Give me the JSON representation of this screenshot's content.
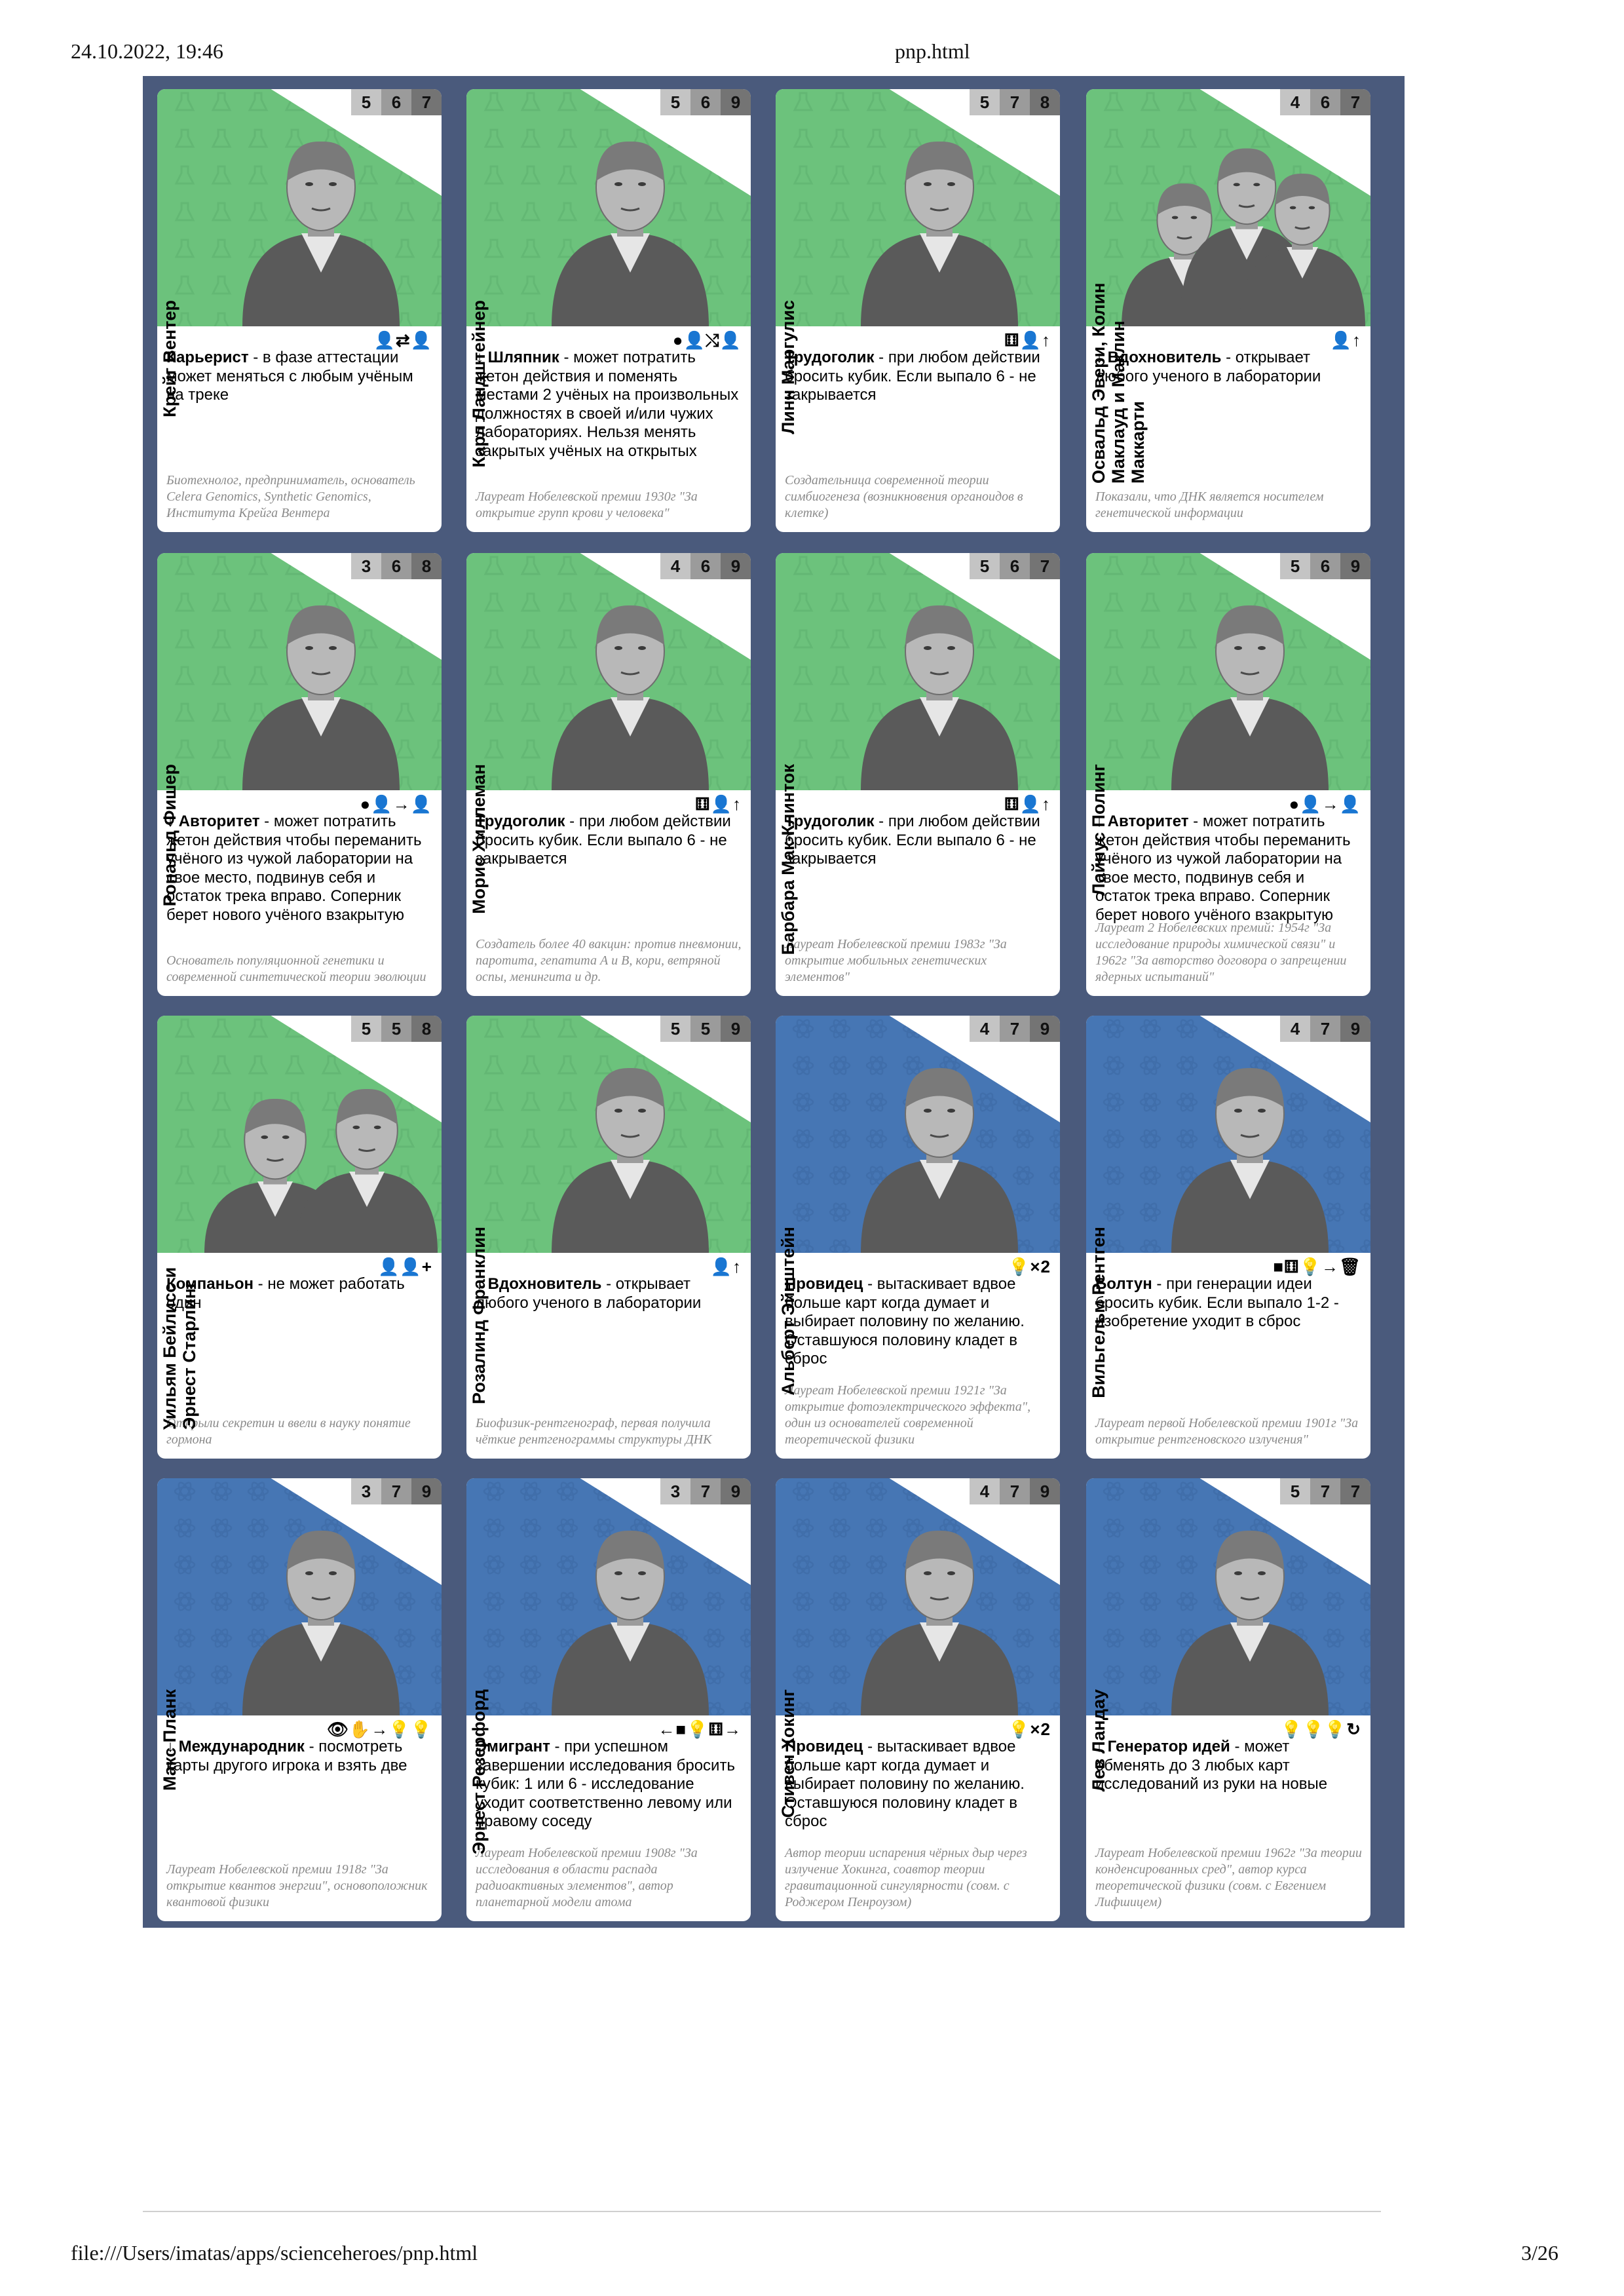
{
  "header": {
    "datetime": "24.10.2022, 19:46",
    "title": "pnp.html"
  },
  "footer": {
    "path": "file:///Users/imatas/apps/scienceheroes/pnp.html",
    "page": "3/26"
  },
  "colors": {
    "sheet": "#4a5a7c",
    "green": "#6cc27c",
    "blue": "#4676b4"
  },
  "cards": [
    {
      "name": "Крейг Вентер",
      "nums": [
        "5",
        "6",
        "7"
      ],
      "bg": "green",
      "icons": "👤⇄👤",
      "arrow": "",
      "ability_title": "Карьерист",
      "ability_text": " - в фазе аттестации может меняться с любым учёным на треке",
      "caption": "Биотехнолог, предприниматель, основатель Celera Genomics, Synthetic Genomics, Института Крейга Вентера"
    },
    {
      "name": "Карл Ландштейнер",
      "nums": [
        "5",
        "6",
        "9"
      ],
      "bg": "green",
      "icons": "●👤⤭👤",
      "arrow": "↓ ",
      "ability_title": "Шляпник",
      "ability_text": " - может потратить жетон действия и поменять местами 2 учёных на произвольных должностях в своей и/или чужих лабораториях. Нельзя менять закрытых учёных на открытых",
      "caption": "Лауреат Нобелевской премии 1930г \"За открытие групп крови у человека\""
    },
    {
      "name": "Линн Маргулис",
      "nums": [
        "5",
        "7",
        "8"
      ],
      "bg": "green",
      "icons": "⚅👤↑",
      "arrow": "",
      "ability_title": "Трудоголик",
      "ability_text": " - при любом действии бросить кубик. Если выпало 6 - не закрывается",
      "caption": "Создательница современной теории симбиогенеза (возникновения органоидов в клетке)"
    },
    {
      "name": "Освальд Эвери, Колин Маклауд и Маклин Маккарти",
      "nums": [
        "4",
        "6",
        "7"
      ],
      "bg": "green",
      "icons": "👤↑",
      "arrow": "↓ ",
      "ability_title": "Вдохновитель",
      "ability_text": " - открывает любого ученого в лаборатории",
      "caption": "Показали, что ДНК является носителем генетической информации"
    },
    {
      "name": "Рональд Фишер",
      "nums": [
        "3",
        "6",
        "8"
      ],
      "bg": "green",
      "icons": "●👤→👤",
      "arrow": "↓ ",
      "ability_title": "Авторитет",
      "ability_text": " - может потратить жетон действия чтобы переманить учёного из чужой лаборатории на свое место, подвинув себя и остаток трека вправо. Соперник берет нового учёного взакрытую",
      "caption": "Основатель популяционной генетики и современной синтетической теории эволюции"
    },
    {
      "name": "Морис Хиллеман",
      "nums": [
        "4",
        "6",
        "9"
      ],
      "bg": "green",
      "icons": "⚅👤↑",
      "arrow": "",
      "ability_title": "Трудоголик",
      "ability_text": " - при любом действии бросить кубик. Если выпало 6 - не закрывается",
      "caption": "Создатель более 40 вакцин: против пневмонии, паротита, гепатита А и В, кори, ветряной оспы, менингита и др."
    },
    {
      "name": "Барбара Мак-Клинток",
      "nums": [
        "5",
        "6",
        "7"
      ],
      "bg": "green",
      "icons": "⚅👤↑",
      "arrow": "",
      "ability_title": "Трудоголик",
      "ability_text": " - при любом действии бросить кубик. Если выпало 6 - не закрывается",
      "caption": "Лауреат Нобелевской премии 1983г \"За открытие мобильных генетических элементов\""
    },
    {
      "name": "Лайнус Полинг",
      "nums": [
        "5",
        "6",
        "9"
      ],
      "bg": "green",
      "icons": "●👤→👤",
      "arrow": "↓ ",
      "ability_title": "Авторитет",
      "ability_text": " - может потратить жетон действия чтобы переманить учёного из чужой лаборатории на свое место, подвинув себя и остаток трека вправо. Соперник берет нового учёного взакрытую",
      "caption": "Лауреат 2 Нобелевских премий: 1954г \"За исследование природы химической связи\" и 1962г \"За авторство договора о запрещении ядерных испытаний\""
    },
    {
      "name": "Уильям Бейлисс и Эрнест Старлинг",
      "nums": [
        "5",
        "5",
        "8"
      ],
      "bg": "green",
      "icons": "👤👤+",
      "arrow": "",
      "ability_title": "Компаньон",
      "ability_text": " - не может работать один",
      "caption": "Открыли секретин и ввели в науку понятие гормона"
    },
    {
      "name": "Розалинд Франклин",
      "nums": [
        "5",
        "5",
        "9"
      ],
      "bg": "green",
      "icons": "👤↑",
      "arrow": "↓ ",
      "ability_title": "Вдохновитель",
      "ability_text": " - открывает любого ученого в лаборатории",
      "caption": "Биофизик-рентгенограф, первая получила чёткие рентгенограммы структуры ДНК"
    },
    {
      "name": "Альберт Эйнштейн",
      "nums": [
        "4",
        "7",
        "9"
      ],
      "bg": "blue",
      "icons": "💡×2",
      "arrow": "",
      "ability_title": "Провидец",
      "ability_text": " - вытаскивает вдвое больше карт когда думает и выбирает половину по желанию. Оставшуюся половину кладет в сброс",
      "caption": "Лауреат Нобелевской премии 1921г \"За открытие фотоэлектрического эффекта\", один из основателей современной теоретической физики"
    },
    {
      "name": "Вильгельм Рентген",
      "nums": [
        "4",
        "7",
        "9"
      ],
      "bg": "blue",
      "icons": "■⚅💡→🗑",
      "arrow": "",
      "ability_title": "Болтун",
      "ability_text": " - при генерации идеи бросить кубик. Если выпало 1-2 - изобретение уходит в сброс",
      "caption": "Лауреат первой Нобелевской премии 1901г \"За открытие рентгеновского излучения\""
    },
    {
      "name": "Макс Планк",
      "nums": [
        "3",
        "7",
        "9"
      ],
      "bg": "blue",
      "icons": "👁✋→💡💡",
      "arrow": "↓ ",
      "ability_title": "Международник",
      "ability_text": " - посмотреть карты другого игрока и взять две",
      "caption": "Лауреат Нобелевской премии 1918г \"За открытие квантов энергии\", основоположник квантовой физики"
    },
    {
      "name": "Эрнест Резерфорд",
      "nums": [
        "3",
        "7",
        "9"
      ],
      "bg": "blue",
      "icons": "←■💡⚅→",
      "arrow": "",
      "ability_title": "Эмигрант",
      "ability_text": " - при успешном завершении исследования бросить кубик: 1 или 6 - исследование уходит соответственно левому или правому соседу",
      "caption": "Лауреат Нобелевской премии 1908г \"За исследования в области распада радиоактивных элементов\", автор планетарной модели атома"
    },
    {
      "name": "Стивен Хокинг",
      "nums": [
        "4",
        "7",
        "9"
      ],
      "bg": "blue",
      "icons": "💡×2",
      "arrow": "",
      "ability_title": "Провидец",
      "ability_text": " - вытаскивает вдвое больше карт когда думает и выбирает половину по желанию. Оставшуюся половину кладет в сброс",
      "caption": "Автор теории испарения чёрных дыр через излучение Хокинга, соавтор теории гравитационной сингулярности (совм. с Роджером Пенроузом)"
    },
    {
      "name": "Лев Ландау",
      "nums": [
        "5",
        "7",
        "7"
      ],
      "bg": "blue",
      "icons": "💡💡💡↻",
      "arrow": "↓ ",
      "ability_title": "Генератор идей",
      "ability_text": " - может обменять до 3 любых карт исследований из руки на новые",
      "caption": "Лауреат Нобелевской премии 1962г \"За теории конденсированных сред\", автор курса теоретической физики (совм. с Евгением Лифшицем)"
    }
  ]
}
